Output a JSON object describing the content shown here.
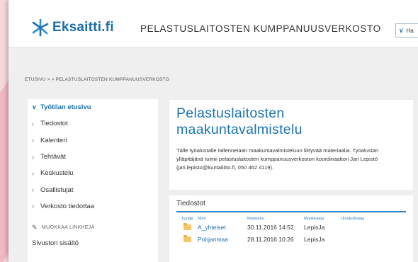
{
  "header": {
    "logo_text": "Eksaitti.fi",
    "site_title": "PELASTUSLAITOSTEN KUMPPANUUSVERKOSTO",
    "dropdown_label": "Ha"
  },
  "breadcrumb": "ETUSIVU > > PELASTUSLAITOSTEN KUMPPANUUSVERKOSTO",
  "sidebar": {
    "items": [
      {
        "label": "Työtilan etusivu",
        "active": true
      },
      {
        "label": "Tiedostot"
      },
      {
        "label": "Kalenteri"
      },
      {
        "label": "Tehtävät"
      },
      {
        "label": "Keskustelu"
      },
      {
        "label": "Osallistujat"
      },
      {
        "label": "Verkosto tiedottaa"
      }
    ],
    "edit_links": "MUOKKAA LINKKEJÄ",
    "site_content": "Sivuston sisältö"
  },
  "intro": {
    "title": "Pelastuslaitosten maakuntavalmistelu",
    "text": "Tälle työalustalle tallennetaan maakuntavalmisteluun liittyvää materiaalia. Työalustan ylläpitäjänä toimii pelastuslaitosten kumppanuusverkoston koordinaattori Jari Lepistö (jari.lepisto@kuntaliitto.fi, 050 462 4119)."
  },
  "files": {
    "title": "Tiedostot",
    "columns": {
      "type": "Tyyppi",
      "name": "Nimi",
      "modified": "Muokattu",
      "modified_by": "Muokkaaja",
      "checked_out": "Uloskuittaaja"
    },
    "rows": [
      {
        "name": "A_yhteiset",
        "modified": "30.11.2016 14:52",
        "modified_by": "LepisJa"
      },
      {
        "name": "Pohjanmaa",
        "modified": "28.11.2016 10:26",
        "modified_by": "LepisJa"
      }
    ]
  },
  "colors": {
    "brand_blue": "#1b73b3",
    "folder": "#f2c86b",
    "background_pink": "#f6d7dd"
  }
}
